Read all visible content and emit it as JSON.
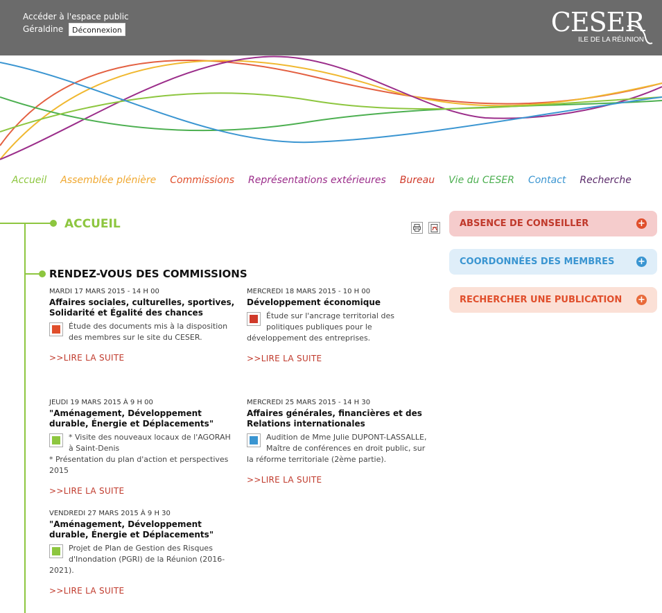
{
  "header": {
    "public_link": "Accéder à l'espace public",
    "user": "Géraldine",
    "logout": "Déconnexion",
    "logo_main": "CESER",
    "logo_sub": "ILE DE LA RÉUNION"
  },
  "nav": {
    "items": [
      {
        "label": "Accueil",
        "color": "#8dc63f"
      },
      {
        "label": "Assemblée plénière",
        "color": "#f0a830"
      },
      {
        "label": "Commissions",
        "color": "#e04e2b"
      },
      {
        "label": "Représentations extérieures",
        "color": "#9b2d8a"
      },
      {
        "label": "Bureau",
        "color": "#d03a2a"
      },
      {
        "label": "Vie du CESER",
        "color": "#4caf50"
      },
      {
        "label": "Contact",
        "color": "#3a95d1"
      },
      {
        "label": "Recherche",
        "color": "#5a2a6a"
      }
    ]
  },
  "page": {
    "title": "ACCUEIL",
    "section_title": "RENDEZ-VOUS DES COMMISSIONS",
    "print_icon": "printer-icon",
    "pdf_icon": "pdf-icon"
  },
  "events": [
    {
      "date": "MARDI 17 MARS 2015 - 14 H 00",
      "title": "Affaires sociales, culturelles, sportives, Solidarité et Égalité des chances",
      "body": "Étude des documents mis à la disposition des membres sur le site du CESER.",
      "color": "#e04e2b",
      "more": ">>LIRE LA SUITE"
    },
    {
      "date": "MERCREDI 18 MARS 2015 - 10 H 00",
      "title": "Développement économique",
      "body": "Étude sur l'ancrage territorial des politiques publiques pour le développement des entreprises.",
      "color": "#d03a2a",
      "more": ">>LIRE LA SUITE"
    },
    {
      "date": "JEUDI 19 MARS 2015 À 9 H 00",
      "title": "\"Aménagement, Développement durable, Énergie et Déplacements\"",
      "body": "* Visite des nouveaux locaux de l'AGORAH à Saint-Denis",
      "body2": "* Présentation du plan d'action et perspectives 2015",
      "color": "#8dc63f",
      "more": ">>LIRE LA SUITE"
    },
    {
      "date": "MERCREDI 25 MARS 2015 - 14 H 30",
      "title": "Affaires générales, financières et des Relations internationales",
      "body": "Audition de Mme Julie DUPONT-LASSALLE, Maître de conférences en droit public, sur la réforme territoriale (2ème partie).",
      "color": "#3a95d1",
      "more": ">>LIRE LA SUITE"
    },
    {
      "date": "VENDREDI 27 MARS 2015 À 9 H 30",
      "title": "\"Aménagement, Développement durable, Énergie et Déplacements\"",
      "body": "Projet de Plan de Gestion des Risques d'Inondation (PGRI) de la Réunion (2016-2021).",
      "color": "#8dc63f",
      "more": ">>LIRE LA SUITE"
    }
  ],
  "sidebar": {
    "buttons": [
      {
        "label": "ABSENCE DE CONSEILLER",
        "text_color": "#c0392b",
        "bg": "#f5cccc",
        "plus_color": "#e04e2b"
      },
      {
        "label": "COORDONNÉES DES MEMBRES",
        "text_color": "#3a95d1",
        "bg": "#dfeef9",
        "plus_color": "#3a95d1"
      },
      {
        "label": "RECHERCHER UNE PUBLICATION",
        "text_color": "#e04e2b",
        "bg": "#fbe0d6",
        "plus_color": "#e86a3a"
      }
    ]
  }
}
